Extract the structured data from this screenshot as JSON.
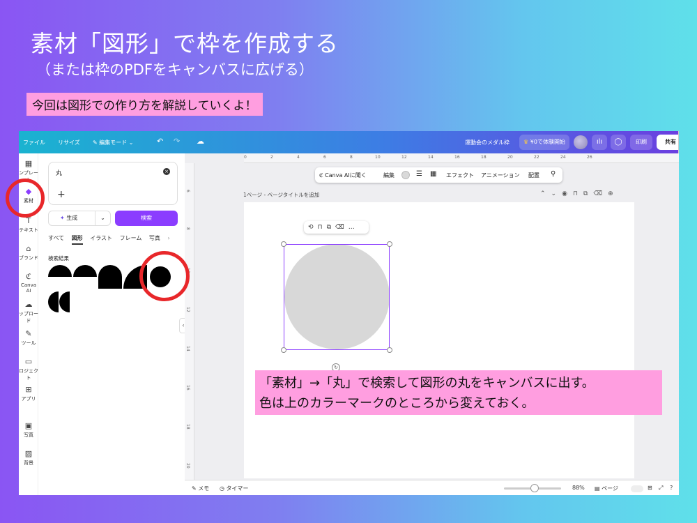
{
  "slide": {
    "title": "素材「図形」で枠を作成する",
    "subtitle": "（または枠のPDFをキャンバスに広げる）",
    "intro_callout": "今回は図形での作り方を解説していくよ！",
    "instruction_line1": "「素材」→「丸」で検索して図形の丸をキャンバスに出す。",
    "instruction_line2": "色は上のカラーマークのところから変えておく。"
  },
  "topbar": {
    "file": "ファイル",
    "resize": "リサイズ",
    "edit_mode": "編集モード",
    "doc_title": "運動会のメダル枠",
    "trial_button": "¥0で体験開始",
    "print": "印刷",
    "share": "共有"
  },
  "rail": {
    "items": [
      {
        "icon": "template-icon",
        "glyph": "▦",
        "label": "ンプレート"
      },
      {
        "icon": "elements-icon",
        "glyph": "◆",
        "label": "素材"
      },
      {
        "icon": "text-icon",
        "glyph": "T",
        "label": "テキスト"
      },
      {
        "icon": "brand-icon",
        "glyph": "⌂",
        "label": "ブランド"
      },
      {
        "icon": "canva-ai-icon",
        "glyph": "ℭ",
        "label": "Canva AI"
      },
      {
        "icon": "upload-icon",
        "glyph": "☁",
        "label": "ップロード"
      },
      {
        "icon": "tools-icon",
        "glyph": "✎",
        "label": "ツール"
      },
      {
        "icon": "projects-icon",
        "glyph": "▭",
        "label": "ロジェクト"
      },
      {
        "icon": "apps-icon",
        "glyph": "⊞",
        "label": "アプリ"
      },
      {
        "icon": "photos-icon",
        "glyph": "▣",
        "label": "写真"
      },
      {
        "icon": "background-icon",
        "glyph": "▨",
        "label": "背景"
      }
    ]
  },
  "panel": {
    "search_query": "丸",
    "generate_label": "生成",
    "search_button": "検索",
    "tabs": [
      "すべて",
      "図形",
      "イラスト",
      "フレーム",
      "写真"
    ],
    "active_tab": "図形",
    "results_label": "検索結果"
  },
  "editor": {
    "ruler_top": [
      "0",
      "2",
      "4",
      "6",
      "8",
      "10",
      "12",
      "14",
      "16",
      "18",
      "20",
      "22",
      "24",
      "26"
    ],
    "ruler_left": [
      "6",
      "8",
      "10",
      "12",
      "14",
      "16",
      "18",
      "20"
    ],
    "toolbar": {
      "canva_ai": "Canva AIに聞く",
      "edit": "編集",
      "effects": "エフェクト",
      "animation": "アニメーション",
      "arrange": "配置"
    },
    "shape_color": "#d8d8d8",
    "page_label": "1ページ - ページタイトルを追加"
  },
  "bottombar": {
    "notes": "メモ",
    "timer": "タイマー",
    "zoom": "88%",
    "pages": "ページ"
  },
  "colors": {
    "accent": "#8b3dff",
    "annotation_red": "#e8272a",
    "callout_pink": "#ff9ee0"
  }
}
